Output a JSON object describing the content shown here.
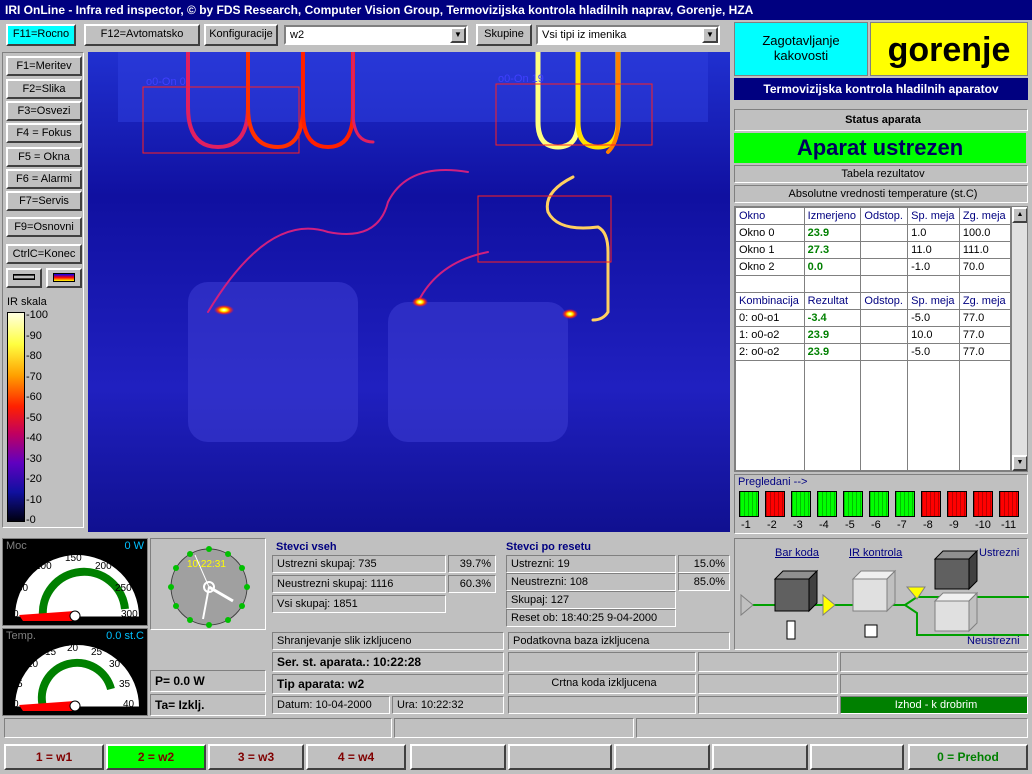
{
  "title": "IRI OnLine - Infra red inspector, © by FDS Research, Computer Vision Group, Termovizijska kontrola hladilnih naprav, Gorenje, HZA",
  "toolbar": {
    "f11": "F11=Rocno",
    "f12": "F12=Avtomatsko",
    "konfig_label": "Konfiguracije",
    "konfig_value": "w2",
    "skupine_label": "Skupine",
    "skupine_value": "Vsi tipi iz imenika"
  },
  "fkeys": [
    "F1=Meritev",
    "F2=Slika",
    "F3=Osvezi",
    "F4 = Fokus",
    "F5 = Okna",
    "F6 = Alarmi",
    "F7=Servis",
    "F9=Osnovni",
    "CtrlC=Konec"
  ],
  "ir_scale": {
    "label": "IR skala",
    "ticks": [
      "100",
      "90",
      "80",
      "70",
      "60",
      "50",
      "40",
      "30",
      "20",
      "10",
      "0"
    ]
  },
  "image_labels": {
    "win0": "o0-On 0",
    "win1": "o0-On 19"
  },
  "brand": {
    "zagot": "Zagotavljanje kakovosti",
    "logo": "gorenje",
    "sub": "Termovizijska kontrola hladilnih aparatov"
  },
  "status": {
    "title": "Status aparata",
    "value": "Aparat ustrezen",
    "tabela": "Tabela rezultatov",
    "abs": "Absolutne vrednosti temperature (st.C)"
  },
  "okna": {
    "headers": [
      "Okno",
      "Izmerjeno",
      "Odstop.",
      "Sp. meja",
      "Zg. meja"
    ],
    "rows": [
      [
        "Okno 0",
        "23.9",
        "",
        "1.0",
        "100.0"
      ],
      [
        "Okno 1",
        "27.3",
        "",
        "11.0",
        "111.0"
      ],
      [
        "Okno 2",
        "0.0",
        "",
        "-1.0",
        "70.0"
      ]
    ]
  },
  "komb": {
    "headers": [
      "Kombinacija",
      "Rezultat",
      "Odstop.",
      "Sp. meja",
      "Zg. meja"
    ],
    "rows": [
      [
        "0: o0-o1",
        "-3.4",
        "",
        "-5.0",
        "77.0"
      ],
      [
        "1: o0-o2",
        "23.9",
        "",
        "10.0",
        "77.0"
      ],
      [
        "2: o0-o2",
        "23.9",
        "",
        "-5.0",
        "77.0"
      ]
    ]
  },
  "pregledani": {
    "label": "Pregledani -->",
    "items": [
      {
        "n": "-1",
        "ok": true
      },
      {
        "n": "-2",
        "ok": false
      },
      {
        "n": "-3",
        "ok": true
      },
      {
        "n": "-4",
        "ok": true
      },
      {
        "n": "-5",
        "ok": true
      },
      {
        "n": "-6",
        "ok": true
      },
      {
        "n": "-7",
        "ok": true
      },
      {
        "n": "-8",
        "ok": false
      },
      {
        "n": "-9",
        "ok": false
      },
      {
        "n": "-10",
        "ok": false
      },
      {
        "n": "-11",
        "ok": false
      }
    ]
  },
  "gauges": {
    "moc": {
      "label": "Moc",
      "value": "0 W",
      "ticks": [
        "0",
        "50",
        "100",
        "150",
        "200",
        "250",
        "300"
      ]
    },
    "temp": {
      "label": "Temp.",
      "value": "0.0 st.C",
      "ticks": [
        "0",
        "5",
        "10",
        "15",
        "20",
        "25",
        "30",
        "35",
        "40"
      ]
    }
  },
  "clock": {
    "time": "10:22:31"
  },
  "stevci_vseh": {
    "title": "Stevci vseh",
    "ustrezni": "Ustrezni skupaj: 735",
    "ustrezni_pct": "39.7%",
    "neustrezni": "Neustrezni skupaj: 1116",
    "neustrezni_pct": "60.3%",
    "skupaj": "Vsi skupaj: 1851"
  },
  "stevci_reset": {
    "title": "Stevci po resetu",
    "ustrezni": "Ustrezni: 19",
    "ustrezni_pct": "15.0%",
    "neustrezni": "Neustrezni: 108",
    "neustrezni_pct": "85.0%",
    "skupaj": "Skupaj: 127",
    "reset": "Reset ob: 18:40:25 9-04-2000"
  },
  "diagram": {
    "barkoda": "Bar koda",
    "ir": "IR kontrola",
    "ustrezni": "Ustrezni",
    "neustrezni": "Neustrezni"
  },
  "info": {
    "shranjevanje": "Shranjevanje slik izkljuceno",
    "baza": "Podatkovna baza izkljucena",
    "ser": "Ser. st. aparata.: 10:22:28",
    "tip": "Tip aparata:  w2",
    "crtna": "Crtna koda izkljucena",
    "p": "P=  0.0 W",
    "ta": "Ta= Izklj.",
    "datum": "Datum: 10-04-2000",
    "ura": "Ura: 10:22:32",
    "izhod": "Izhod - k drobrim"
  },
  "bottom": {
    "b1": "1 = w1",
    "b2": "2 = w2",
    "b3": "3 = w3",
    "b4": "4 = w4",
    "b0": "0 = Prehod"
  },
  "colors": {
    "ok": "#00ff00",
    "bad": "#ff0000",
    "title": "#000080",
    "thermal_bg": "#0a0ab0"
  }
}
